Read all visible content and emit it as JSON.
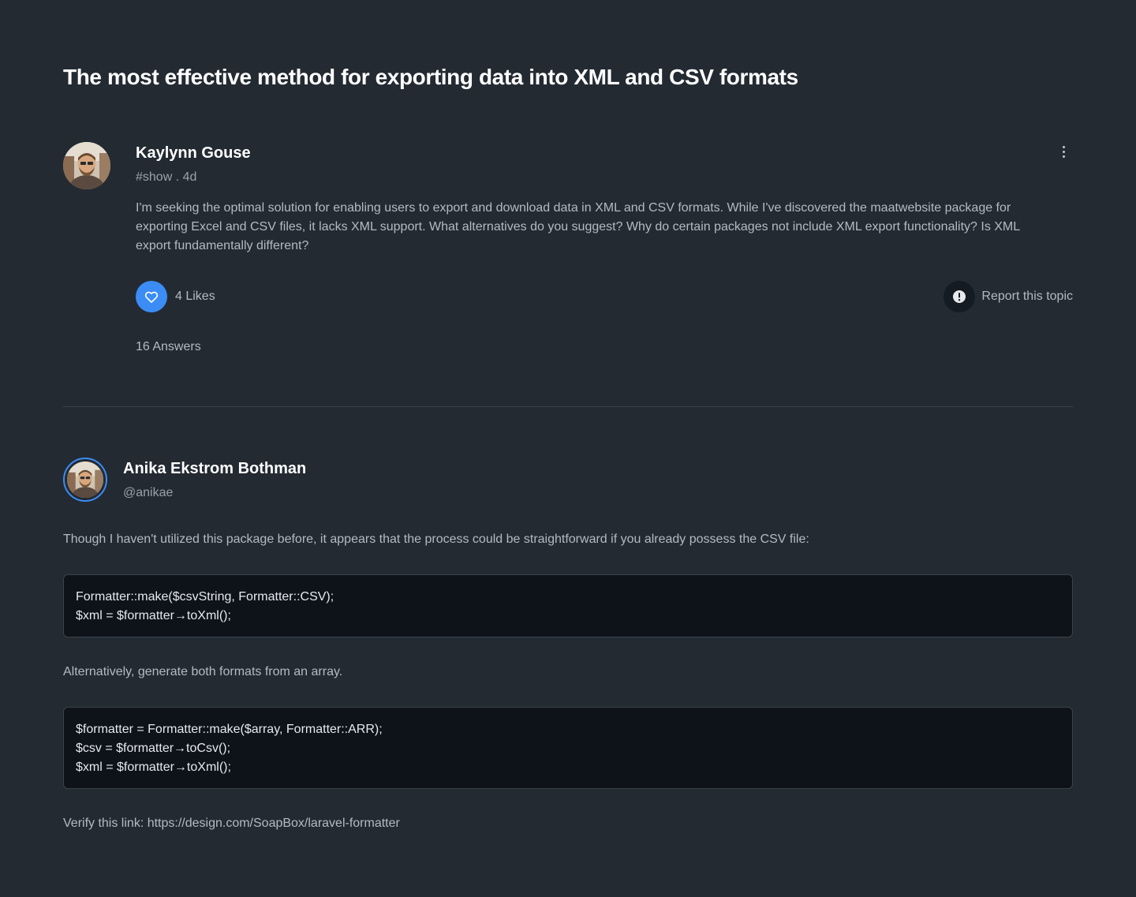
{
  "topic": {
    "title": "The most effective method for exporting data into XML and CSV formats",
    "author_name": "Kaylynn Gouse",
    "meta": "#show . 4d",
    "body": "I'm seeking the optimal solution for enabling users to export and download data in XML and CSV formats. While I've discovered the maatwebsite package for exporting Excel and CSV files, it lacks XML support. What alternatives do you suggest? Why do certain packages not include XML export functionality? Is XML export fundamentally different?",
    "likes_label": "4 Likes",
    "report_label": "Report this topic",
    "answers_label": "16 Answers",
    "like_icon": "heart-icon",
    "report_icon": "alert-icon",
    "more_icon": "more-vertical-icon"
  },
  "answer": {
    "author_name": "Anika Ekstrom Bothman",
    "handle": "@anikae",
    "intro": "Though I haven't utilized this package before, it appears that the process could be straightforward if you already possess the CSV file:",
    "code1": [
      "Formatter::make($csvString, Formatter::CSV);",
      "$xml = $formatter→toXml();"
    ],
    "middle": "Alternatively, generate both formats from an array.",
    "code2": [
      "$formatter = Formatter::make($array, Formatter::ARR);",
      "$csv = $formatter→toCsv();",
      "$xml = $formatter→toXml();"
    ],
    "outro": "Verify this link: https://design.com/SoapBox/laravel-formatter"
  },
  "colors": {
    "background": "#232a32",
    "accent": "#3b8cf5",
    "code_background": "#0e131a"
  }
}
